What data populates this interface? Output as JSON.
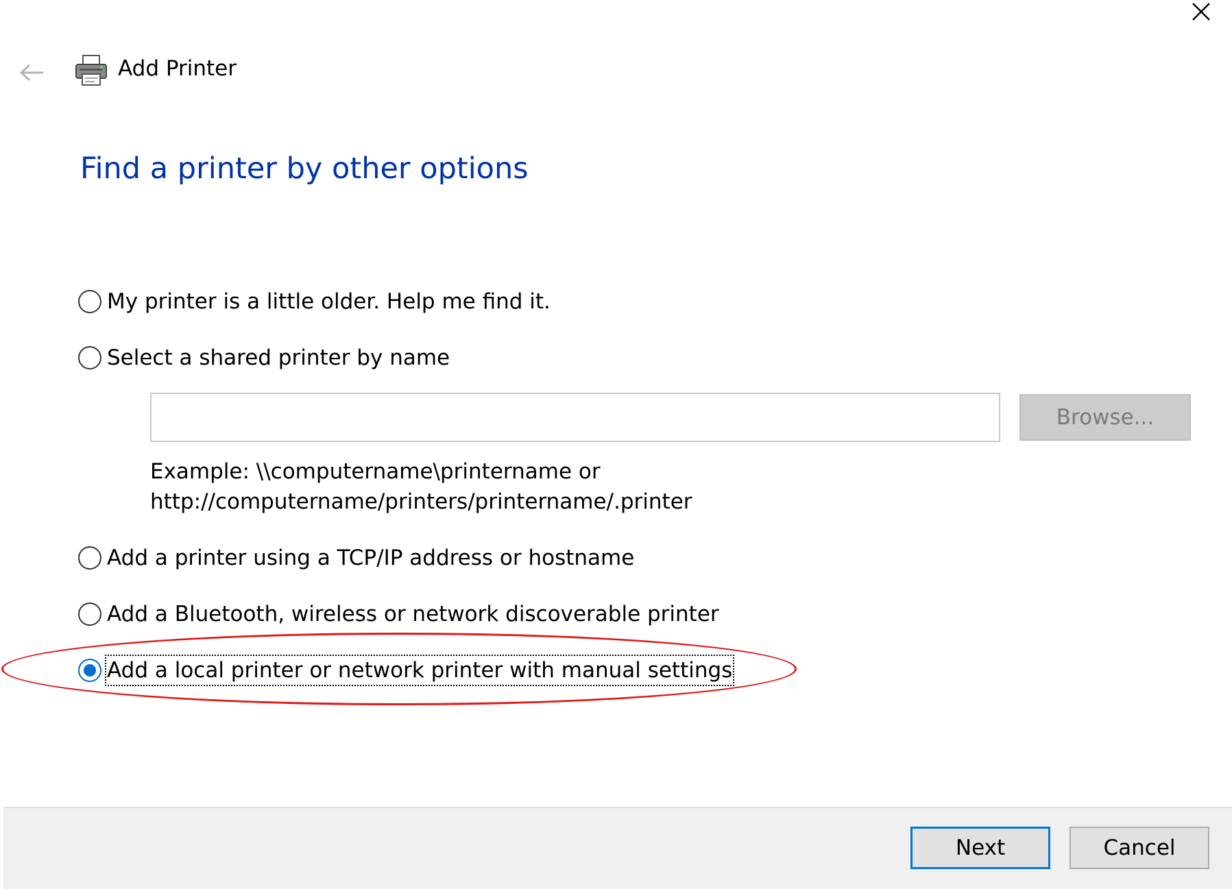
{
  "window": {
    "title": "Add Printer",
    "close_icon": "close-icon",
    "back_icon": "back-arrow-icon",
    "app_icon": "printer-icon"
  },
  "heading": "Find a printer by other options",
  "options": [
    {
      "label": "My printer is a little older. Help me find it.",
      "checked": false
    },
    {
      "label": "Select a shared printer by name",
      "checked": false
    },
    {
      "label": "Add a printer using a TCP/IP address or hostname",
      "checked": false
    },
    {
      "label": "Add a Bluetooth, wireless or network discoverable printer",
      "checked": false
    },
    {
      "label": "Add a local printer or network printer with manual settings",
      "checked": true
    }
  ],
  "shared_printer": {
    "value": "",
    "placeholder": "",
    "browse_label": "Browse...",
    "example_line1": "Example: \\\\computername\\printername or",
    "example_line2": "http://computername/printers/printername/.printer"
  },
  "footer": {
    "next_label": "Next",
    "cancel_label": "Cancel"
  },
  "colors": {
    "heading": "#0033a8",
    "radio_selected": "#0a6ed1",
    "annotation": "#e01919",
    "footer_bg": "#f0f0f0"
  }
}
